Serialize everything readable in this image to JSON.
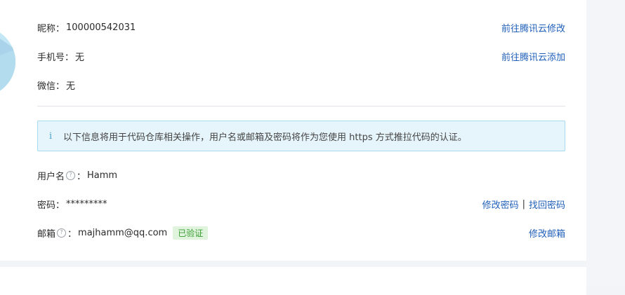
{
  "profile": {
    "nickname": {
      "label": "昵称：",
      "value": "100000542031",
      "action": "前往腾讯云修改"
    },
    "phone": {
      "label": "手机号：",
      "value": "无",
      "action": "前往腾讯云添加"
    },
    "wechat": {
      "label": "微信：",
      "value": "无"
    }
  },
  "notice": {
    "icon": "info-icon",
    "text": "以下信息将用于代码仓库相关操作，用户名或邮箱及密码将作为您使用 https 方式推拉代码的认证。"
  },
  "account": {
    "username": {
      "label": "用户名",
      "colon": "：",
      "value": "Hamm"
    },
    "password": {
      "label": "密码：",
      "value": "*********",
      "change_action": "修改密码",
      "separator": "|",
      "recover_action": "找回密码"
    },
    "email": {
      "label": "邮箱",
      "colon": "：",
      "value": "majhamm@qq.com",
      "badge": "已验证",
      "action": "修改邮箱"
    }
  },
  "help_icon_glyph": "?",
  "colors": {
    "link": "#1f5fb8",
    "notice_bg": "#e6f5fb",
    "notice_border": "#a8dbf1",
    "badge_bg": "#e0f4dd",
    "badge_text": "#3a9d34"
  }
}
